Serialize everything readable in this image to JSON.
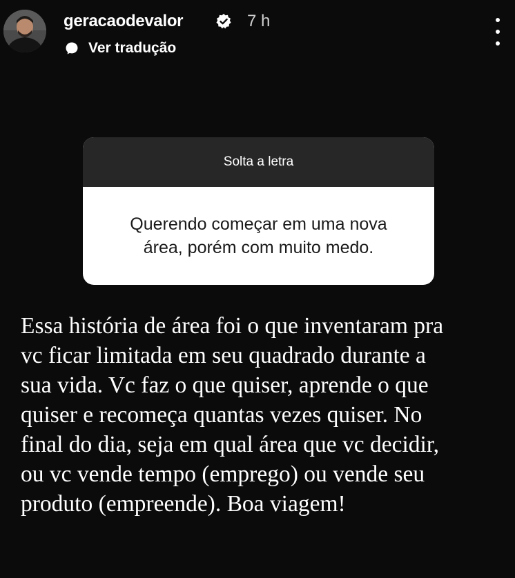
{
  "header": {
    "username": "geracaodevalor",
    "time": "7 h",
    "translate_label": "Ver tradução",
    "icons": {
      "avatar": "profile-avatar",
      "verified": "verified-badge-icon",
      "translate": "chat-bubble-icon",
      "more": "more-vertical-icon"
    }
  },
  "question_sticker": {
    "title": "Solta a letra",
    "question_lines": [
      "Querendo começar em uma nova",
      "área, porém com muito medo."
    ]
  },
  "answer": {
    "lines": [
      "Essa história de área foi o que inventaram pra",
      "vc ficar limitada em seu quadrado durante a",
      "sua vida. Vc faz o que quiser, aprende o que",
      "quiser e recomeça quantas vezes quiser. No",
      "final do dia, seja em qual área que vc decidir,",
      "ou vc vende tempo (emprego) ou vende seu",
      "produto (empreende). Boa viagem!"
    ]
  },
  "colors": {
    "background": "#0b0b0b",
    "sticker_header": "#272727",
    "sticker_body": "#ffffff",
    "text": "#ffffff"
  }
}
